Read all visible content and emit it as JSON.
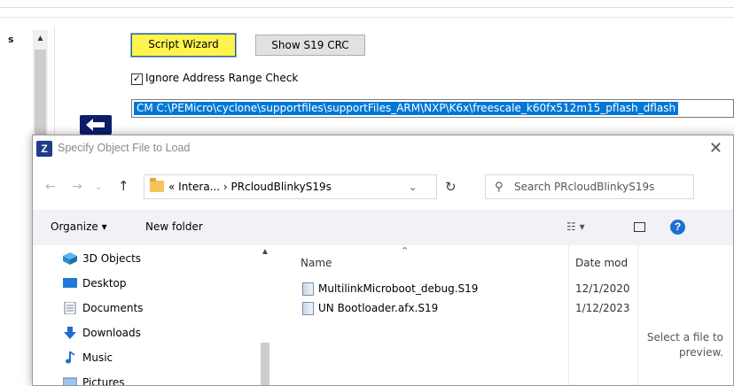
{
  "background": {
    "left_label": "s",
    "script_wizard_label": "Script Wizard",
    "show_crc_label": "Show S19 CRC",
    "ignore_checkbox": {
      "checked": true,
      "label": "Ignore Address Range Check"
    },
    "path_value": "CM  C:\\PEMicro\\cyclone\\supportfiles\\supportFiles_ARM\\NXP\\K6x\\freescale_k60fx512m15_pflash_dflash"
  },
  "dialog": {
    "title": "Specify Object File to Load",
    "address": "«  Intera...  ›  PRcloudBlinkyS19s",
    "search_placeholder": "Search PRcloudBlinkyS19s",
    "toolbar": {
      "organize": "Organize ▾",
      "new_folder": "New folder"
    },
    "tree": [
      {
        "label": "3D Objects",
        "icon": "3d-objects-icon"
      },
      {
        "label": "Desktop",
        "icon": "desktop-icon"
      },
      {
        "label": "Documents",
        "icon": "documents-icon"
      },
      {
        "label": "Downloads",
        "icon": "downloads-icon"
      },
      {
        "label": "Music",
        "icon": "music-icon"
      },
      {
        "label": "Pictures",
        "icon": "pictures-icon"
      }
    ],
    "columns": {
      "name": "Name",
      "date": "Date modi"
    },
    "files": [
      {
        "name": "MultilinkMicroboot_debug.S19",
        "date": "12/1/2020"
      },
      {
        "name": "UN Bootloader.afx.S19",
        "date": "1/12/2023"
      }
    ],
    "preview_text": "Select a file to preview.",
    "colors": {
      "accent": "#0078d7",
      "wizard_highlight": "#fff44d",
      "help": "#1f6fd1"
    }
  }
}
